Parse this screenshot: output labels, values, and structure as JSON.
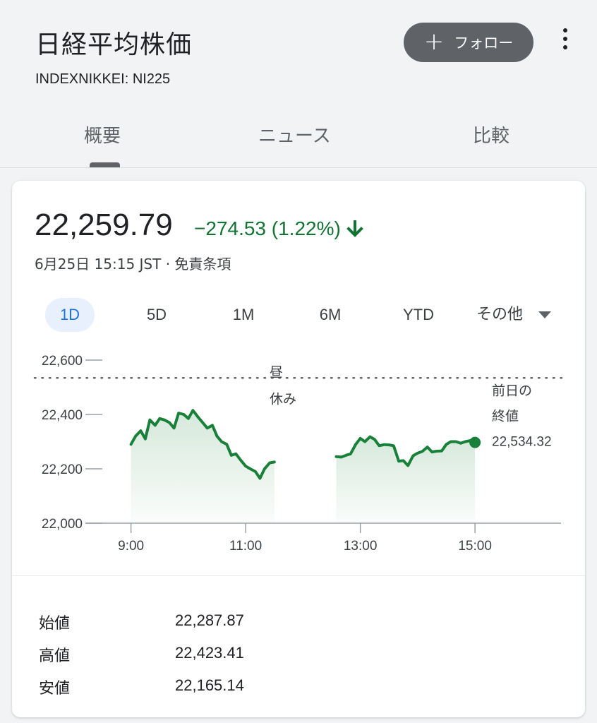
{
  "header": {
    "title": "日経平均株価",
    "ticker": "INDEXNIKKEI: NI225",
    "follow_label": "フォロー",
    "follow_icon": "plus-icon",
    "menu_icon": "more-vert-icon",
    "tabs": [
      {
        "label": "概要",
        "active": true
      },
      {
        "label": "ニュース",
        "active": false
      },
      {
        "label": "比較",
        "active": false
      }
    ]
  },
  "quote": {
    "price": "22,259.79",
    "change": "−274.53 (1.22%)",
    "direction_icon": "arrow-down-icon",
    "timestamp": "6月25日 15:15 JST · 免責条項",
    "down_color": "#137333"
  },
  "ranges": {
    "items": [
      "1D",
      "5D",
      "1M",
      "6M",
      "YTD"
    ],
    "active": "1D",
    "more_label": "その他"
  },
  "chart_data": {
    "type": "area",
    "line_color": "#188038",
    "y_ticks": [
      "22,600",
      "22,400",
      "22,200",
      "22,000"
    ],
    "x_ticks": [
      "9:00",
      "11:00",
      "13:00",
      "15:00"
    ],
    "ylim": [
      22000,
      22600
    ],
    "lunch_label": "昼休み",
    "prev_close_label": "前日の終値",
    "prev_close_value": "22,534.32",
    "prev_close": 22534.32,
    "morning": {
      "x": [
        9.0,
        9.08,
        9.17,
        9.25,
        9.33,
        9.42,
        9.5,
        9.58,
        9.67,
        9.75,
        9.83,
        9.92,
        10.0,
        10.08,
        10.17,
        10.25,
        10.33,
        10.42,
        10.5,
        10.58,
        10.67,
        10.75,
        10.83,
        10.92,
        11.0,
        11.08,
        11.17,
        11.25,
        11.33,
        11.42,
        11.5
      ],
      "y": [
        22290,
        22320,
        22340,
        22310,
        22380,
        22360,
        22385,
        22380,
        22370,
        22350,
        22405,
        22400,
        22385,
        22415,
        22390,
        22370,
        22350,
        22360,
        22320,
        22300,
        22290,
        22250,
        22255,
        22230,
        22210,
        22200,
        22190,
        22165,
        22200,
        22222,
        22225
      ]
    },
    "afternoon": {
      "x": [
        12.58,
        12.67,
        12.75,
        12.83,
        12.92,
        13.0,
        13.08,
        13.17,
        13.25,
        13.33,
        13.42,
        13.5,
        13.58,
        13.67,
        13.75,
        13.83,
        13.92,
        14.0,
        14.08,
        14.17,
        14.25,
        14.33,
        14.42,
        14.5,
        14.58,
        14.67,
        14.75,
        14.83,
        14.92,
        15.0
      ],
      "y": [
        22245,
        22243,
        22250,
        22255,
        22290,
        22312,
        22300,
        22318,
        22308,
        22285,
        22289,
        22288,
        22285,
        22228,
        22230,
        22212,
        22248,
        22258,
        22264,
        22280,
        22262,
        22265,
        22266,
        22290,
        22300,
        22300,
        22294,
        22300,
        22304,
        22297
      ]
    },
    "last_point": {
      "x": 15.0,
      "y": 22297
    }
  },
  "stats": [
    {
      "label": "始値",
      "value": "22,287.87"
    },
    {
      "label": "高値",
      "value": "22,423.41"
    },
    {
      "label": "安値",
      "value": "22,165.14"
    }
  ]
}
